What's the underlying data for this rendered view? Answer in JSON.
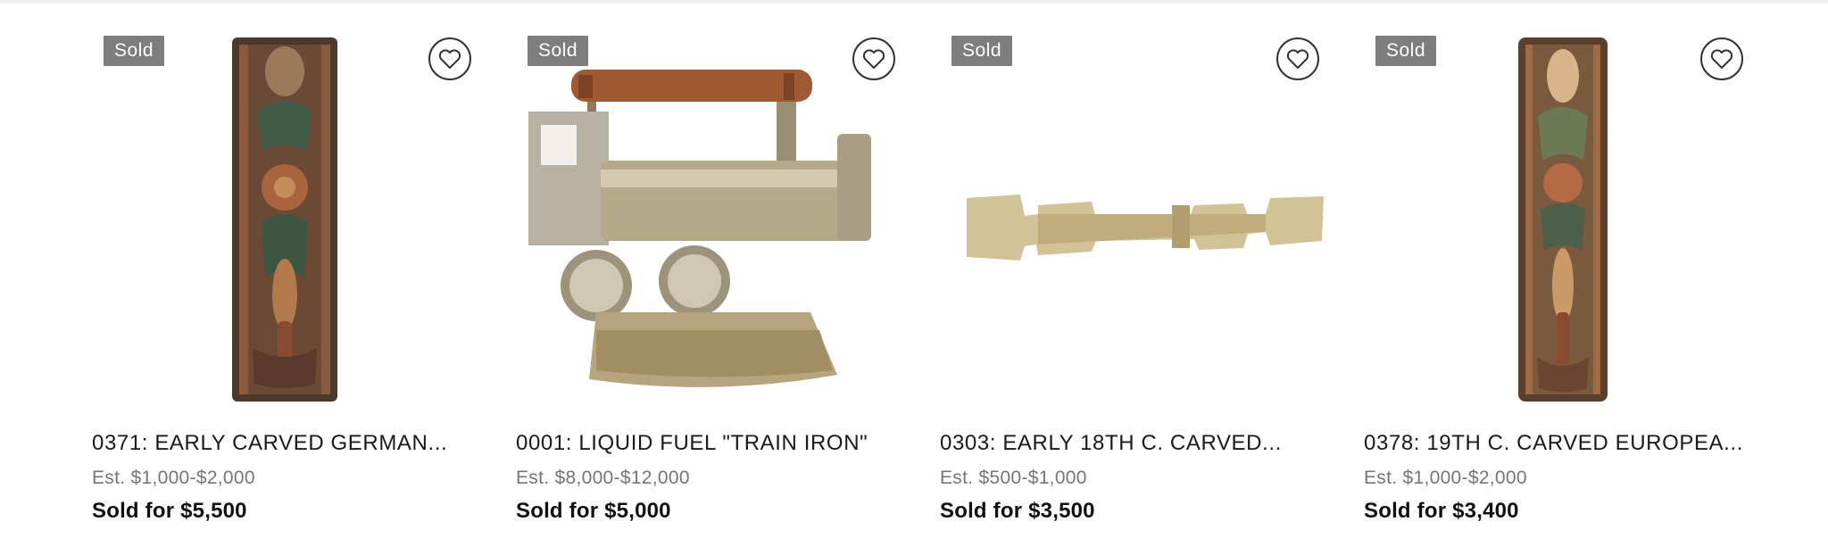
{
  "lots": [
    {
      "badge": "Sold",
      "title": "0371: EARLY CARVED GERMAN...",
      "estimate": "Est. $1,000-$2,000",
      "sold_price": "Sold for $5,500",
      "image_icon": "carved-panel-image",
      "favorite_icon": "heart-icon"
    },
    {
      "badge": "Sold",
      "title": "0001: LIQUID FUEL \"TRAIN IRON\"",
      "estimate": "Est. $8,000-$12,000",
      "sold_price": "Sold for $5,000",
      "image_icon": "train-iron-image",
      "favorite_icon": "heart-icon"
    },
    {
      "badge": "Sold",
      "title": "0303: EARLY 18TH C. CARVED...",
      "estimate": "Est. $500-$1,000",
      "sold_price": "Sold for $3,500",
      "image_icon": "carved-wood-bar-image",
      "favorite_icon": "heart-icon"
    },
    {
      "badge": "Sold",
      "title": "0378: 19TH C. CARVED EUROPEA...",
      "estimate": "Est. $1,000-$2,000",
      "sold_price": "Sold for $3,400",
      "image_icon": "carved-panel-image",
      "favorite_icon": "heart-icon"
    }
  ],
  "colors": {
    "badge_bg": "#7d7d7d",
    "text_primary": "#1a1a1a",
    "text_muted": "#757575"
  }
}
